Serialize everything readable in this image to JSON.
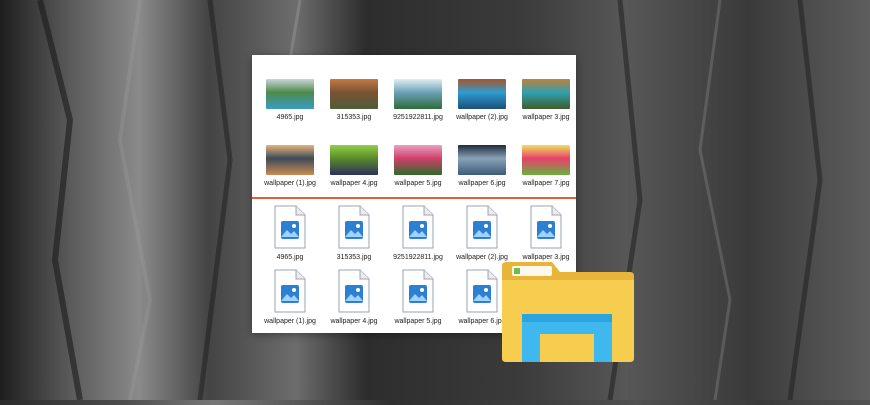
{
  "top_files": [
    {
      "name": "4965.jpg",
      "colors": [
        "#3a9bc7",
        "#4c8b4a",
        "#c9d4d6"
      ]
    },
    {
      "name": "315353.jpg",
      "colors": [
        "#4c5d3a",
        "#7b5234",
        "#c07a45"
      ]
    },
    {
      "name": "9251922811.jpg",
      "colors": [
        "#2f6b3a",
        "#6aa0b8",
        "#e0eef0"
      ]
    },
    {
      "name": "wallpaper  (2).jpg",
      "colors": [
        "#1d4f7a",
        "#2e9bd0",
        "#a8552a"
      ]
    },
    {
      "name": "wallpaper  3.jpg",
      "colors": [
        "#3f5e2a",
        "#2fa0b0",
        "#c0803a"
      ]
    },
    {
      "name": "wallpaper (1).jpg",
      "colors": [
        "#c98b52",
        "#3d4a5a",
        "#e4b47a"
      ]
    },
    {
      "name": "wallpaper 4.jpg",
      "colors": [
        "#2b2f5c",
        "#5a8a2a",
        "#8fd04a"
      ]
    },
    {
      "name": "wallpaper 5.jpg",
      "colors": [
        "#2f6b2a",
        "#d0406a",
        "#e8a0c0"
      ]
    },
    {
      "name": "wallpaper 6.jpg",
      "colors": [
        "#3d5a78",
        "#8aa2b8",
        "#1e2c3a"
      ]
    },
    {
      "name": "wallpaper 7.jpg",
      "colors": [
        "#6ab040",
        "#e8406a",
        "#f0e060"
      ]
    }
  ],
  "bottom_files": [
    {
      "name": "4965.jpg"
    },
    {
      "name": "315353.jpg"
    },
    {
      "name": "9251922811.jpg"
    },
    {
      "name": "wallpaper  (2).jpg"
    },
    {
      "name": "wallpaper  3.jpg"
    },
    {
      "name": "wallpaper (1).jpg"
    },
    {
      "name": "wallpaper 4.jpg"
    },
    {
      "name": "wallpaper 5.jpg"
    },
    {
      "name": "wallpaper 6.jpg"
    }
  ],
  "colors": {
    "divider": "#e0603a",
    "file_icon_blue": "#2d7fd6",
    "folder_yellow": "#f5c842",
    "folder_blue": "#3fb8f0"
  },
  "icons": {
    "file": "image-file-icon",
    "app": "file-explorer-icon"
  }
}
